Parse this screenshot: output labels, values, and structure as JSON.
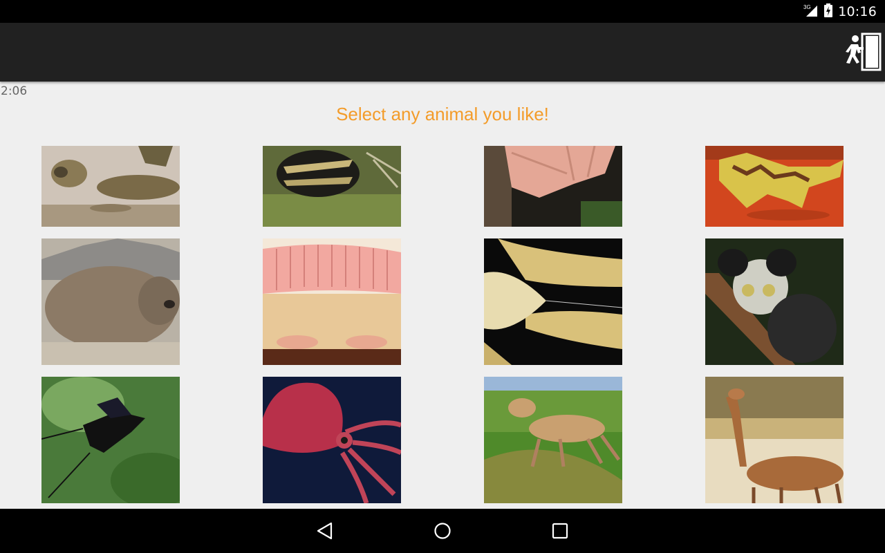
{
  "status_bar": {
    "network": "3G",
    "time": "10:16",
    "icons": [
      "signal-icon",
      "battery-icon"
    ]
  },
  "app_bar": {
    "exit_icon": "exit-door-icon"
  },
  "timer": "2:06",
  "heading": "Select any animal you like!",
  "animals": [
    {
      "name": "mudskipper",
      "row": 0,
      "col": 0
    },
    {
      "name": "tenrec",
      "row": 0,
      "col": 1
    },
    {
      "name": "bat-wing",
      "row": 0,
      "col": 2
    },
    {
      "name": "thorny-devil",
      "row": 0,
      "col": 3
    },
    {
      "name": "wombat",
      "row": 1,
      "col": 0
    },
    {
      "name": "pink-fairy-armadillo",
      "row": 1,
      "col": 1
    },
    {
      "name": "yeti-crab",
      "row": 1,
      "col": 2
    },
    {
      "name": "aye-aye",
      "row": 1,
      "col": 3
    },
    {
      "name": "drongo",
      "row": 2,
      "col": 0
    },
    {
      "name": "squid",
      "row": 2,
      "col": 1
    },
    {
      "name": "saiga-antelope",
      "row": 2,
      "col": 2
    },
    {
      "name": "gerenuk",
      "row": 2,
      "col": 3
    }
  ],
  "nav_bar": {
    "icons": [
      "back-icon",
      "home-icon",
      "recents-icon"
    ]
  }
}
